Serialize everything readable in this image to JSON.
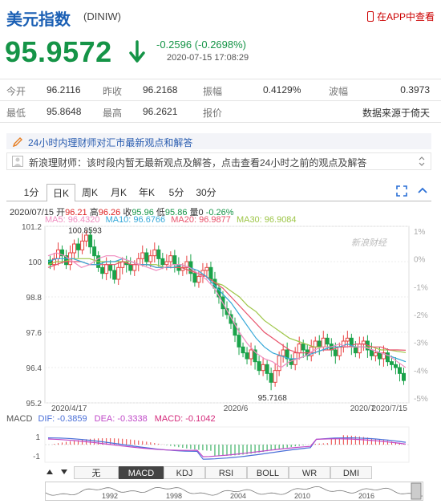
{
  "header": {
    "title": "美元指数",
    "code": "(DINIW)",
    "app_link": "在APP中查看"
  },
  "quote": {
    "price": "95.9572",
    "change": "-0.2596 (-0.2698%)",
    "timestamp": "2020-07-15 17:08:29",
    "color": "#159447"
  },
  "stats": {
    "row1": [
      {
        "label": "今开",
        "value": "96.2116"
      },
      {
        "label": "昨收",
        "value": "96.2168"
      },
      {
        "label": "振幅",
        "value": "0.4129%"
      },
      {
        "label": "波幅",
        "value": "0.3973"
      }
    ],
    "row2": [
      {
        "label": "最低",
        "value": "95.8648"
      },
      {
        "label": "最高",
        "value": "96.2621"
      },
      {
        "label": "报价",
        "value": ""
      },
      {
        "label": "",
        "value": "数据来源于倚天"
      }
    ]
  },
  "banner": {
    "headline": "24小时内理财师对汇市最新观点和解答",
    "message": "新浪理财师：该时段内暂无最新观点及解答，点击查看24小时之前的观点及解答"
  },
  "tabs": [
    "1分",
    "日K",
    "周K",
    "月K",
    "年K",
    "5分",
    "30分"
  ],
  "selected_tab": "日K",
  "ohlc": {
    "date": "2020/07/15",
    "open_label": "开",
    "open": "96.21",
    "high_label": "高",
    "high": "96.26",
    "close_label": "收",
    "close": "95.96",
    "low_label": "低",
    "low": "95.86",
    "vol_label": "量",
    "vol": "0",
    "pct": "-0.26%"
  },
  "ma": {
    "ma5": "MA5: 96.4320",
    "ma10": "MA10: 96.6766",
    "ma20": "MA20: 96.9877",
    "ma30": "MA30: 96.9084",
    "colors": {
      "ma5": "#f08dc0",
      "ma10": "#35a8d8",
      "ma20": "#e8516a",
      "ma30": "#9ec648"
    }
  },
  "chart_data": {
    "type": "candlestick",
    "y_left_ticks": [
      "101.2",
      "100",
      "98.8",
      "97.6",
      "96.4",
      "95.2"
    ],
    "y_right_ticks": [
      "1%",
      "0%",
      "-1%",
      "-2%",
      "-3%",
      "-4%",
      "-5%"
    ],
    "x_labels": [
      "2020/4/17",
      "2020/6",
      "2020/7",
      "2020/7/15"
    ],
    "high_marker": "100.8593",
    "low_marker": "95.7168",
    "watermark": "新浪财经",
    "ylim": [
      95.2,
      101.2
    ],
    "closes": [
      99.9,
      100.1,
      100.4,
      100.2,
      99.9,
      100.3,
      100.6,
      100.4,
      100.7,
      100.9,
      100.5,
      100.2,
      99.8,
      99.6,
      99.9,
      99.7,
      99.4,
      99.8,
      100.0,
      99.9,
      99.7,
      99.9,
      100.1,
      100.3,
      100.0,
      100.2,
      100.4,
      100.1,
      99.9,
      100.0,
      100.2,
      99.9,
      99.7,
      99.8,
      100.0,
      99.6,
      99.3,
      99.5,
      99.7,
      99.8,
      99.4,
      99.1,
      98.8,
      98.4,
      98.2,
      97.9,
      97.5,
      97.1,
      96.9,
      96.7,
      97.0,
      96.6,
      96.3,
      96.5,
      96.2,
      95.9,
      96.3,
      96.8,
      97.0,
      96.7,
      96.5,
      96.9,
      97.2,
      97.0,
      96.8,
      97.1,
      97.3,
      97.1,
      97.4,
      97.2,
      97.0,
      96.8,
      97.1,
      97.3,
      97.4,
      97.1,
      96.9,
      97.2,
      97.3,
      97.0,
      96.8,
      96.9,
      96.7,
      96.9,
      96.6,
      96.5,
      96.4,
      96.2,
      95.96
    ],
    "ma5": [
      100.2,
      100.3,
      100.2,
      100.0,
      99.8,
      99.9,
      100.1,
      100.2,
      100.2,
      100.1,
      100.0,
      99.9,
      99.8,
      99.7,
      99.8,
      99.9,
      99.9,
      99.8,
      99.6,
      99.4,
      99.1,
      98.6,
      98.1,
      97.6,
      97.2,
      96.9,
      96.7,
      96.6,
      96.4,
      96.6,
      96.7,
      96.8,
      97.0,
      97.1,
      97.1,
      97.2,
      97.1,
      97.1,
      97.1,
      97.0,
      96.9,
      96.8,
      96.6,
      96.4
    ],
    "ma10": [
      100.0,
      100.1,
      100.1,
      100.1,
      100.0,
      99.9,
      99.9,
      100.0,
      100.0,
      100.1,
      100.0,
      99.9,
      99.9,
      99.8,
      99.8,
      99.8,
      99.9,
      99.8,
      99.7,
      99.5,
      99.2,
      98.9,
      98.6,
      98.2,
      97.8,
      97.4,
      97.1,
      96.9,
      96.8,
      96.7,
      96.7,
      96.8,
      96.9,
      97.0,
      97.1,
      97.1,
      97.2,
      97.1,
      97.1,
      97.0,
      96.9,
      96.8,
      96.7,
      96.6
    ],
    "ma20": [
      99.8,
      99.9,
      100.0,
      100.0,
      100.0,
      99.9,
      99.9,
      99.9,
      99.9,
      100.0,
      99.9,
      99.9,
      99.9,
      99.8,
      99.8,
      99.8,
      99.8,
      99.7,
      99.6,
      99.5,
      99.3,
      99.1,
      98.8,
      98.5,
      98.2,
      97.9,
      97.6,
      97.4,
      97.2,
      97.0,
      96.9,
      96.9,
      96.9,
      97.0,
      97.0,
      97.1,
      97.1,
      97.2,
      97.2,
      97.1,
      97.1,
      97.0,
      97.0,
      96.99
    ],
    "ma30": [
      99.9,
      100.0,
      100.0,
      100.1,
      100.1,
      100.1,
      100.0,
      100.0,
      100.0,
      100.0,
      100.0,
      99.9,
      99.9,
      99.9,
      99.8,
      99.8,
      99.8,
      99.7,
      99.6,
      99.5,
      99.3,
      99.2,
      99.0,
      98.8,
      98.5,
      98.3,
      98.0,
      97.8,
      97.6,
      97.4,
      97.3,
      97.2,
      97.1,
      97.1,
      97.1,
      97.1,
      97.1,
      97.1,
      97.1,
      97.1,
      97.0,
      97.0,
      96.95,
      96.91
    ]
  },
  "macd": {
    "label": "MACD",
    "dif": "DIF: -0.3859",
    "dea": "DEA: -0.3338",
    "macd": "MACD: -0.1042",
    "ticks": [
      "1",
      "-1"
    ],
    "colors": {
      "dif": "#4a6fd8",
      "dea": "#c049c8",
      "macd": "#d42a7b"
    }
  },
  "indicators": [
    "无",
    "MACD",
    "KDJ",
    "RSI",
    "BOLL",
    "WR",
    "DMI"
  ],
  "selected_indicator": "MACD",
  "navigator_years": [
    "1992",
    "1998",
    "2004",
    "2010",
    "2016"
  ]
}
